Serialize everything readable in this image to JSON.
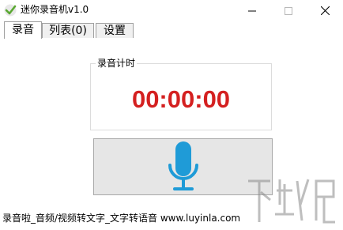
{
  "window": {
    "title": "迷你录音机v1.0",
    "controls": {
      "minimize": "minimize-icon",
      "maximize": "maximize-icon",
      "close": "close-icon"
    }
  },
  "tabs": [
    {
      "label": "录音",
      "active": true
    },
    {
      "label": "列表(0)",
      "active": false
    },
    {
      "label": "设置",
      "active": false
    }
  ],
  "record_panel": {
    "group_label": "录音计时",
    "timer": "00:00:00",
    "record_button_icon": "microphone-icon"
  },
  "status_bar": {
    "text": "录音啦_音频/视频转文字_文字转语音 www.luyinla.com"
  },
  "watermark": {
    "text": "下载吧"
  },
  "colors": {
    "timer": "#d42020",
    "microphone": "#1f9bd7",
    "app_icon": "#5aa832"
  }
}
